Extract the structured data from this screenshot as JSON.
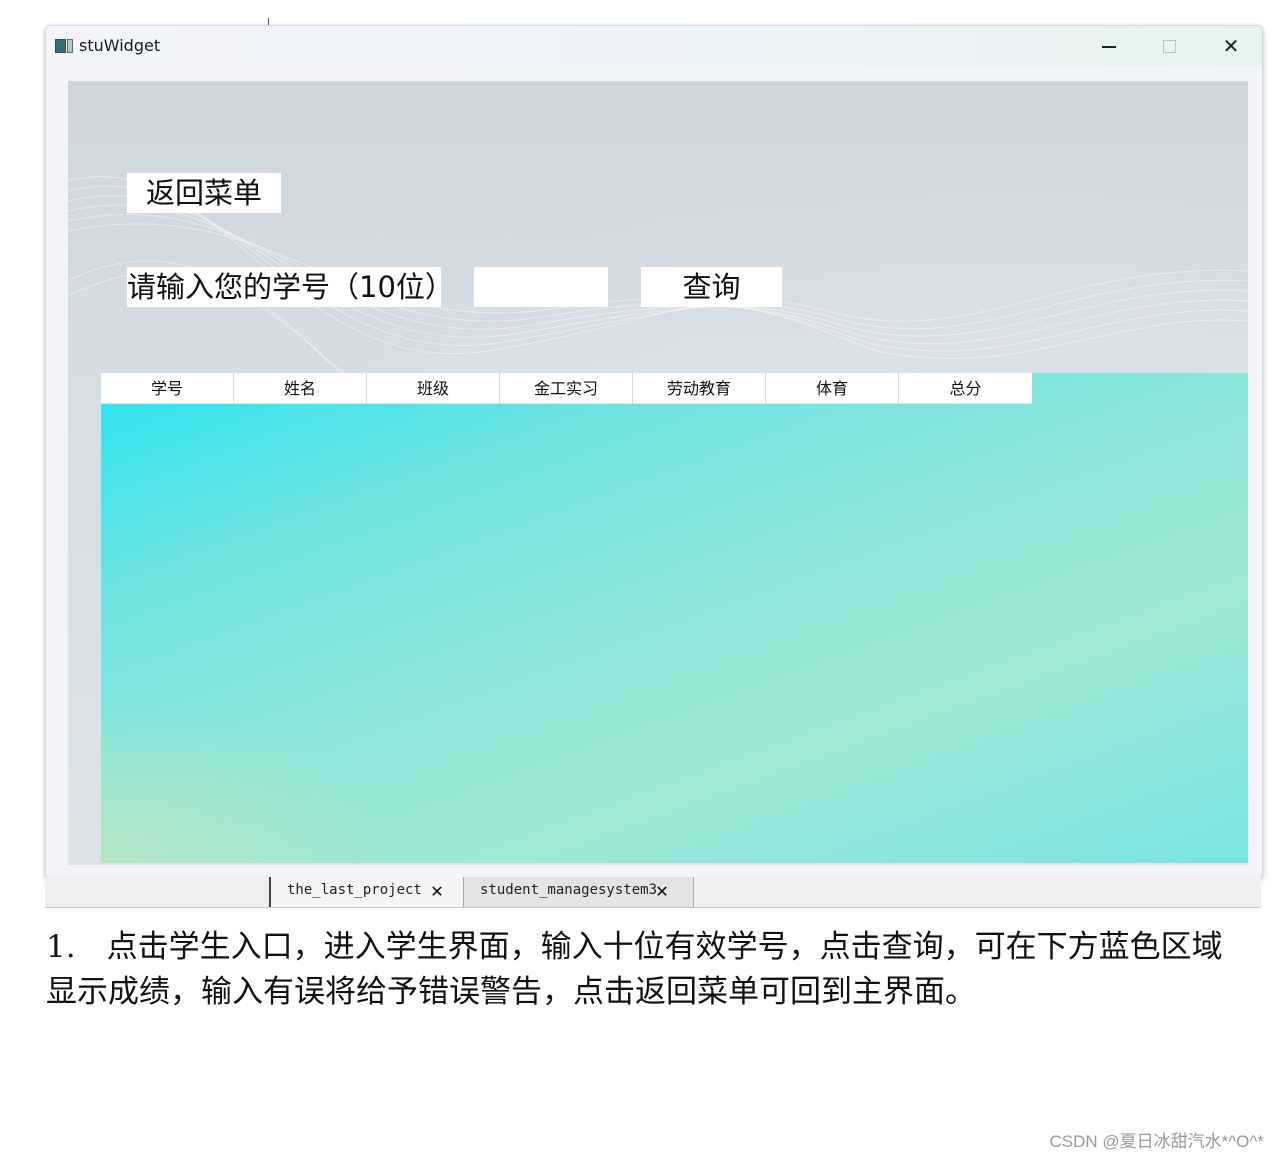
{
  "window": {
    "title": "stuWidget",
    "controls": {
      "minimize": "minimize-icon",
      "maximize": "maximize-icon",
      "close": "close-icon"
    }
  },
  "form": {
    "back_button_label": "返回菜单",
    "prompt_label": "请输入您的学号（10位）",
    "student_id_value": "",
    "query_button_label": "查询"
  },
  "table": {
    "headers": [
      "学号",
      "姓名",
      "班级",
      "金工实习",
      "劳动教育",
      "体育",
      "总分"
    ],
    "rows": []
  },
  "editor_tabs": [
    {
      "label": "the_last_project",
      "close_icon": "close-tab-icon"
    },
    {
      "label": "student_managesystem3",
      "close_icon": "close-tab-icon"
    }
  ],
  "caption": "1.　点击学生入口，进入学生界面，输入十位有效学号，点击查询，可在下方蓝色区域显示成绩，输入有误将给予错误警告，点击返回菜单可回到主界面。",
  "watermark": "CSDN @夏日冰甜汽水*^O^*",
  "colors": {
    "results_area": "#6ee3e0",
    "background": "#d5dde5"
  }
}
